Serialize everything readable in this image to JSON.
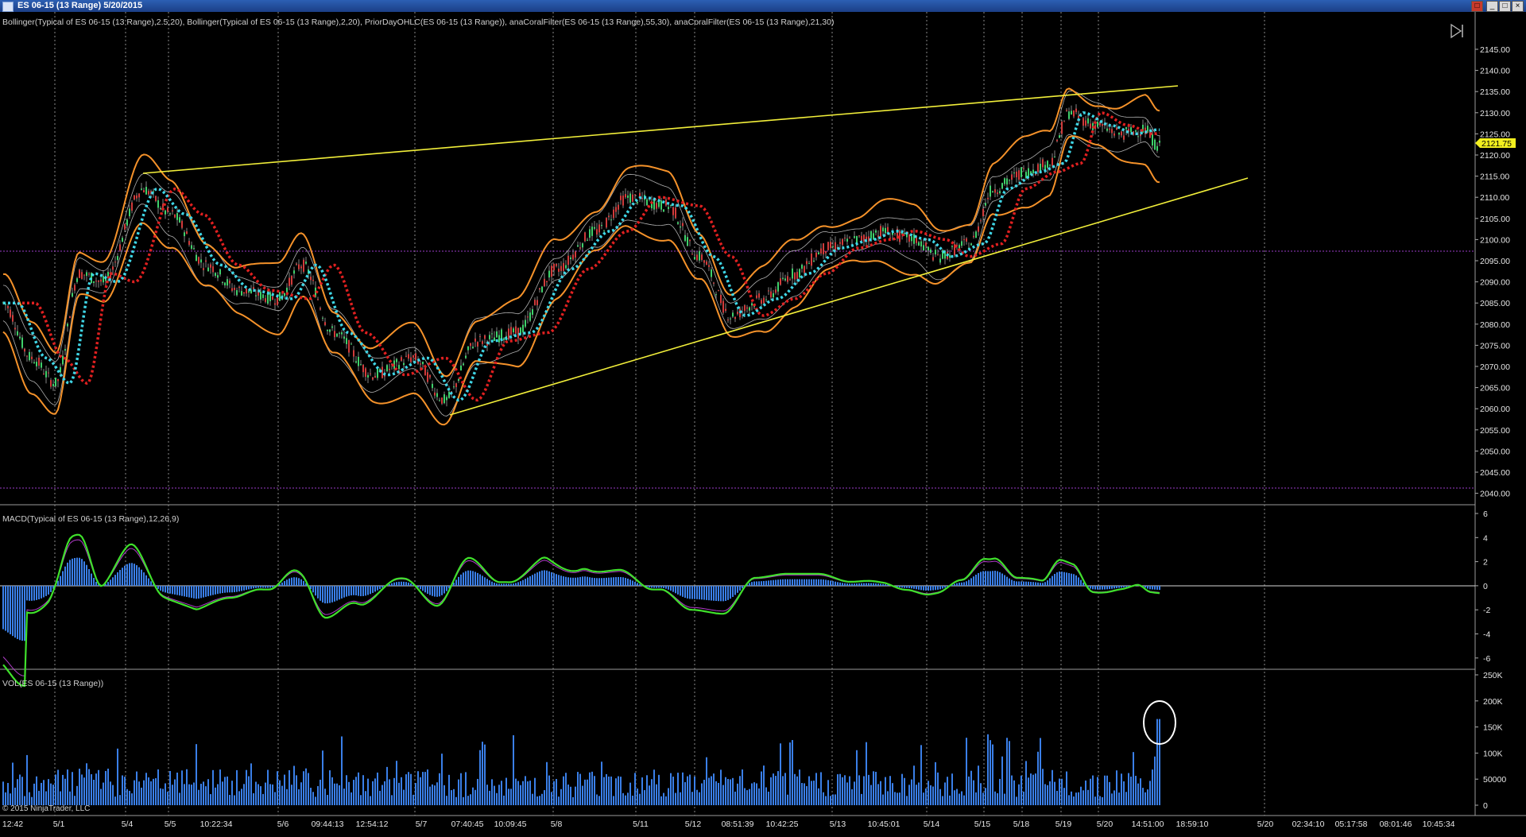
{
  "window": {
    "title": "ES 06-15 (13 Range)  5/20/2015",
    "buttons": [
      "_",
      "□",
      "×"
    ],
    "title_left_button": "□"
  },
  "panels": {
    "price": {
      "indicator_label": "Bollinger(Typical of ES 06-15 (13 Range),2.5,20), Bollinger(Typical of ES 06-15 (13 Range),2,20), PriorDayOHLC(ES 06-15 (13 Range)), anaCoralFilter(ES 06-15 (13 Range),55,30), anaCoralFilter(ES 06-15 (13 Range),21,30)",
      "axis_ticks": [
        "2145.00",
        "2140.00",
        "2135.00",
        "2130.00",
        "2125.00",
        "2120.00",
        "2115.00",
        "2110.00",
        "2105.00",
        "2100.00",
        "2095.00",
        "2090.00",
        "2085.00",
        "2080.00",
        "2075.00",
        "2070.00",
        "2065.00",
        "2060.00",
        "2055.00",
        "2050.00",
        "2045.00",
        "2040.00"
      ],
      "current_price": "2121.75"
    },
    "macd": {
      "indicator_label": "MACD(Typical of ES 06-15 (13 Range),12,26,9)",
      "axis_ticks": [
        "6",
        "4",
        "2",
        "0",
        "-2",
        "-4",
        "-6"
      ]
    },
    "volume": {
      "indicator_label": "VOL(ES 06-15 (13 Range))",
      "axis_ticks": [
        "250K",
        "200K",
        "150K",
        "100K",
        "50000",
        "0"
      ]
    }
  },
  "time_axis": {
    "labels": [
      "12:42",
      "5/1",
      "5/4",
      "5/5",
      "10:22:34",
      "5/6",
      "09:44:13",
      "12:54:12",
      "5/7",
      "07:40:45",
      "10:09:45",
      "5/8",
      "5/11",
      "5/12",
      "08:51:39",
      "10:42:25",
      "5/13",
      "10:45:01",
      "5/14",
      "5/15",
      "5/18",
      "5/19",
      "5/20",
      "14:51:00",
      "18:59:10",
      "5/20",
      "02:34:10",
      "05:17:58",
      "08:01:46",
      "10:45:34"
    ]
  },
  "copyright": "© 2015 NinjaTrader, LLC",
  "colors": {
    "background": "#000000",
    "bollinger_outer": "#f5922a",
    "bollinger_inner": "#b0b0b0",
    "coral_slow_down": "#e02020",
    "coral_fast_up": "#3fd6e6",
    "coral_flat": "#f2ef1f",
    "trendline": "#f2ef3a",
    "prior_day": "#9a3cc8",
    "macd_line": "#3fe02b",
    "macd_signal": "#b03cc8",
    "histogram": "#3a7fe8",
    "volume": "#3a7fe8",
    "price_label_bg": "#f2ef1f"
  }
}
